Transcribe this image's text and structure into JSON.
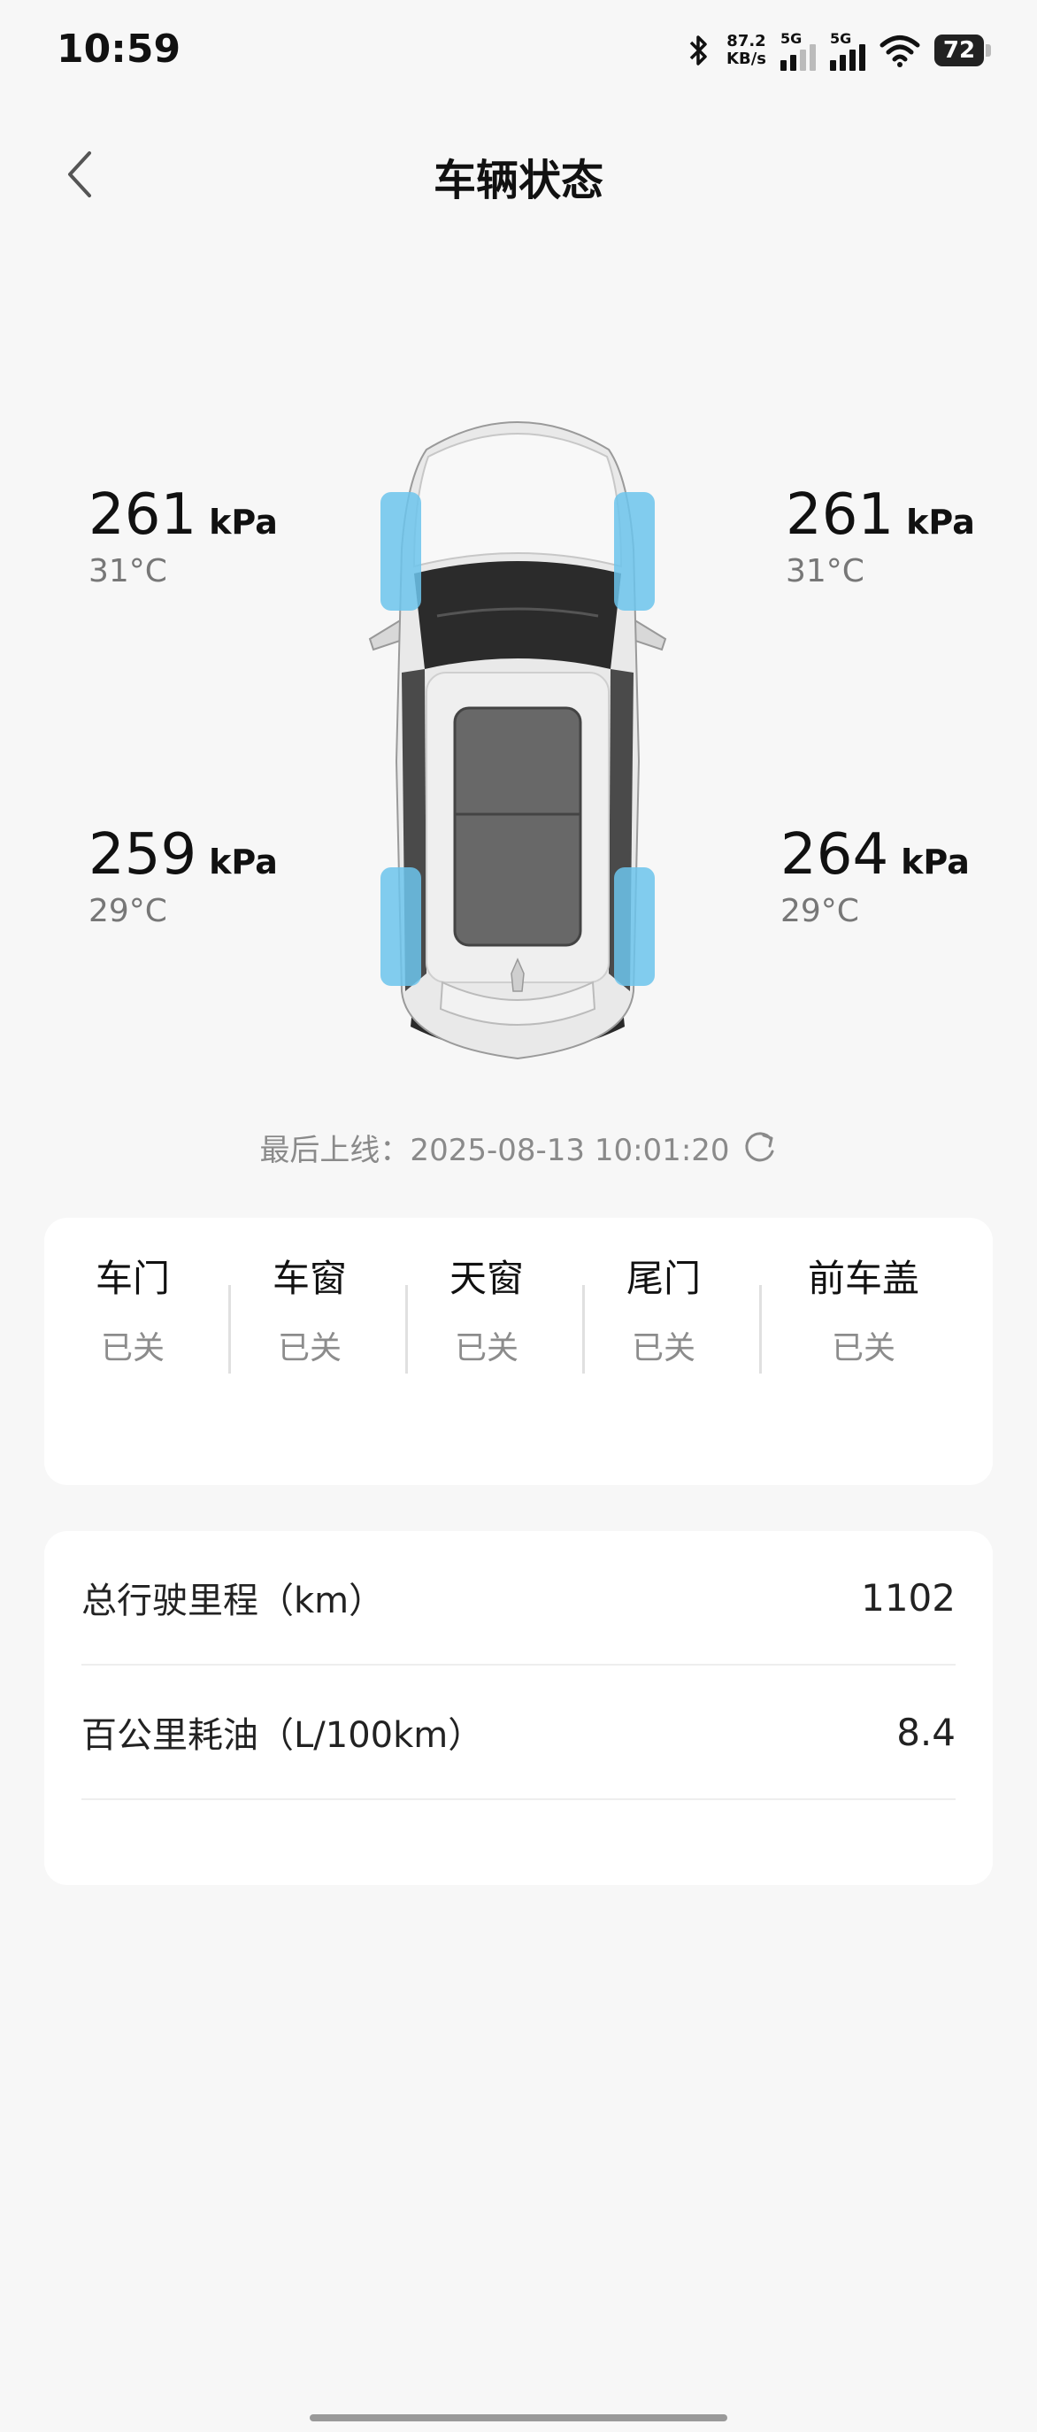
{
  "status_bar": {
    "time": "10:59",
    "net_speed_value": "87.2",
    "net_speed_unit": "KB/s",
    "signal1_label": "5G",
    "signal2_label": "5G",
    "battery": "72",
    "icons": [
      "bluetooth-icon",
      "signal-icon",
      "signal-icon",
      "wifi-icon",
      "battery-icon"
    ]
  },
  "header": {
    "title": "车辆状态",
    "back_icon": "chevron-left-icon"
  },
  "tires": {
    "front_left": {
      "pressure": "261",
      "unit": "kPa",
      "temp": "31°C"
    },
    "front_right": {
      "pressure": "261",
      "unit": "kPa",
      "temp": "31°C"
    },
    "rear_left": {
      "pressure": "259",
      "unit": "kPa",
      "temp": "29°C"
    },
    "rear_right": {
      "pressure": "264",
      "unit": "kPa",
      "temp": "29°C"
    }
  },
  "last_online": {
    "text": "最后上线：2025-08-13 10:01:20",
    "refresh_icon": "refresh-icon"
  },
  "status_items": [
    {
      "name": "车门",
      "value": "已关"
    },
    {
      "name": "车窗",
      "value": "已关"
    },
    {
      "name": "天窗",
      "value": "已关"
    },
    {
      "name": "尾门",
      "value": "已关"
    },
    {
      "name": "前车盖",
      "value": "已关"
    }
  ],
  "stats": [
    {
      "label": "总行驶里程（km）",
      "value": "1102"
    },
    {
      "label": "百公里耗油（L/100km）",
      "value": "8.4"
    }
  ],
  "colors": {
    "background": "#f7f7f7",
    "card": "#ffffff",
    "tire_highlight": "#6cc4ec",
    "secondary_text": "#8c8c8c"
  }
}
